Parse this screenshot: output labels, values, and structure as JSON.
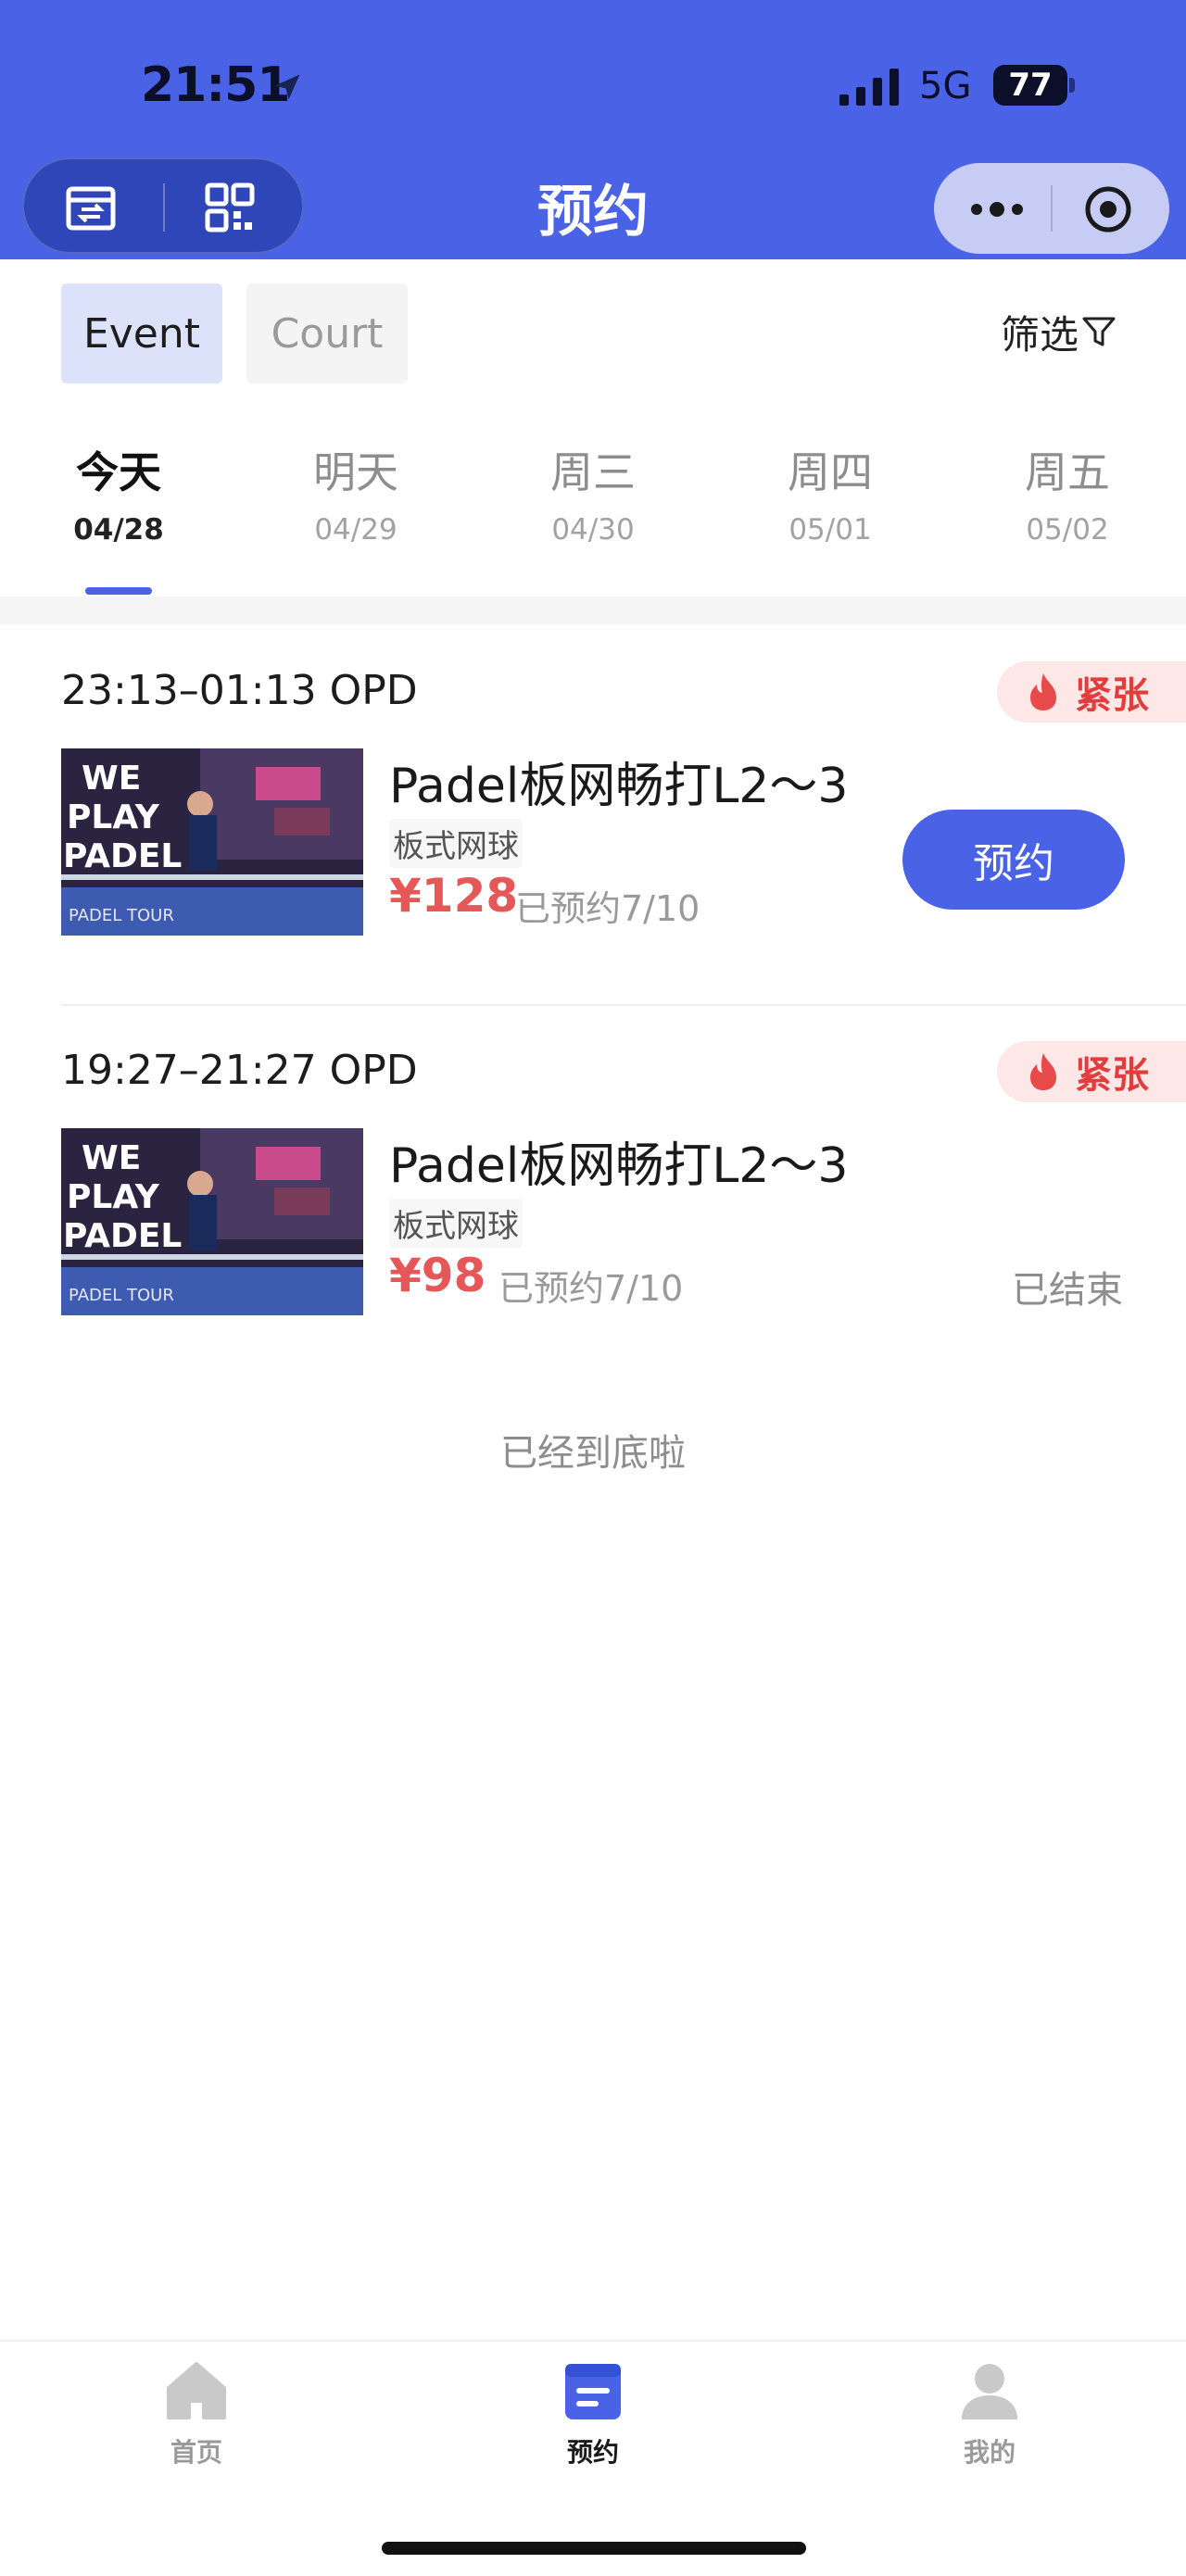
{
  "status_bar": {
    "time": "21:51",
    "network": "5G",
    "battery": "77"
  },
  "header": {
    "title": "预约"
  },
  "type_tabs": [
    {
      "label": "Event",
      "active": true
    },
    {
      "label": "Court",
      "active": false
    }
  ],
  "filter": {
    "label": "筛选"
  },
  "date_tabs": [
    {
      "name": "今天",
      "date": "04/28",
      "active": true
    },
    {
      "name": "明天",
      "date": "04/29",
      "active": false
    },
    {
      "name": "周三",
      "date": "04/30",
      "active": false
    },
    {
      "name": "周四",
      "date": "05/01",
      "active": false
    },
    {
      "name": "周五",
      "date": "05/02",
      "active": false
    }
  ],
  "events": [
    {
      "time_loc": "23:13–01:13  OPD",
      "badge": "紧张",
      "title": "Padel板网畅打L2～3",
      "tag": "板式网球",
      "price": "¥128",
      "booked": "已预约7/10",
      "action": "预约"
    },
    {
      "time_loc": "19:27–21:27  OPD",
      "badge": "紧张",
      "title": "Padel板网畅打L2～3",
      "tag": "板式网球",
      "price": "¥98",
      "booked": "已预约7/10",
      "status": "已结束"
    }
  ],
  "thumb_text": [
    "WE",
    "PLAY",
    "PADEL",
    "PADEL TOUR"
  ],
  "bottom_note": "已经到底啦",
  "tabbar": [
    {
      "label": "首页",
      "icon": "home-icon",
      "active": false
    },
    {
      "label": "预约",
      "icon": "booking-icon",
      "active": true
    },
    {
      "label": "我的",
      "icon": "profile-icon",
      "active": false
    }
  ],
  "colors": {
    "brand": "#4a63e6",
    "price": "#e65757",
    "badge_text": "#e23c3c",
    "badge_bg": "#fde7e7"
  }
}
